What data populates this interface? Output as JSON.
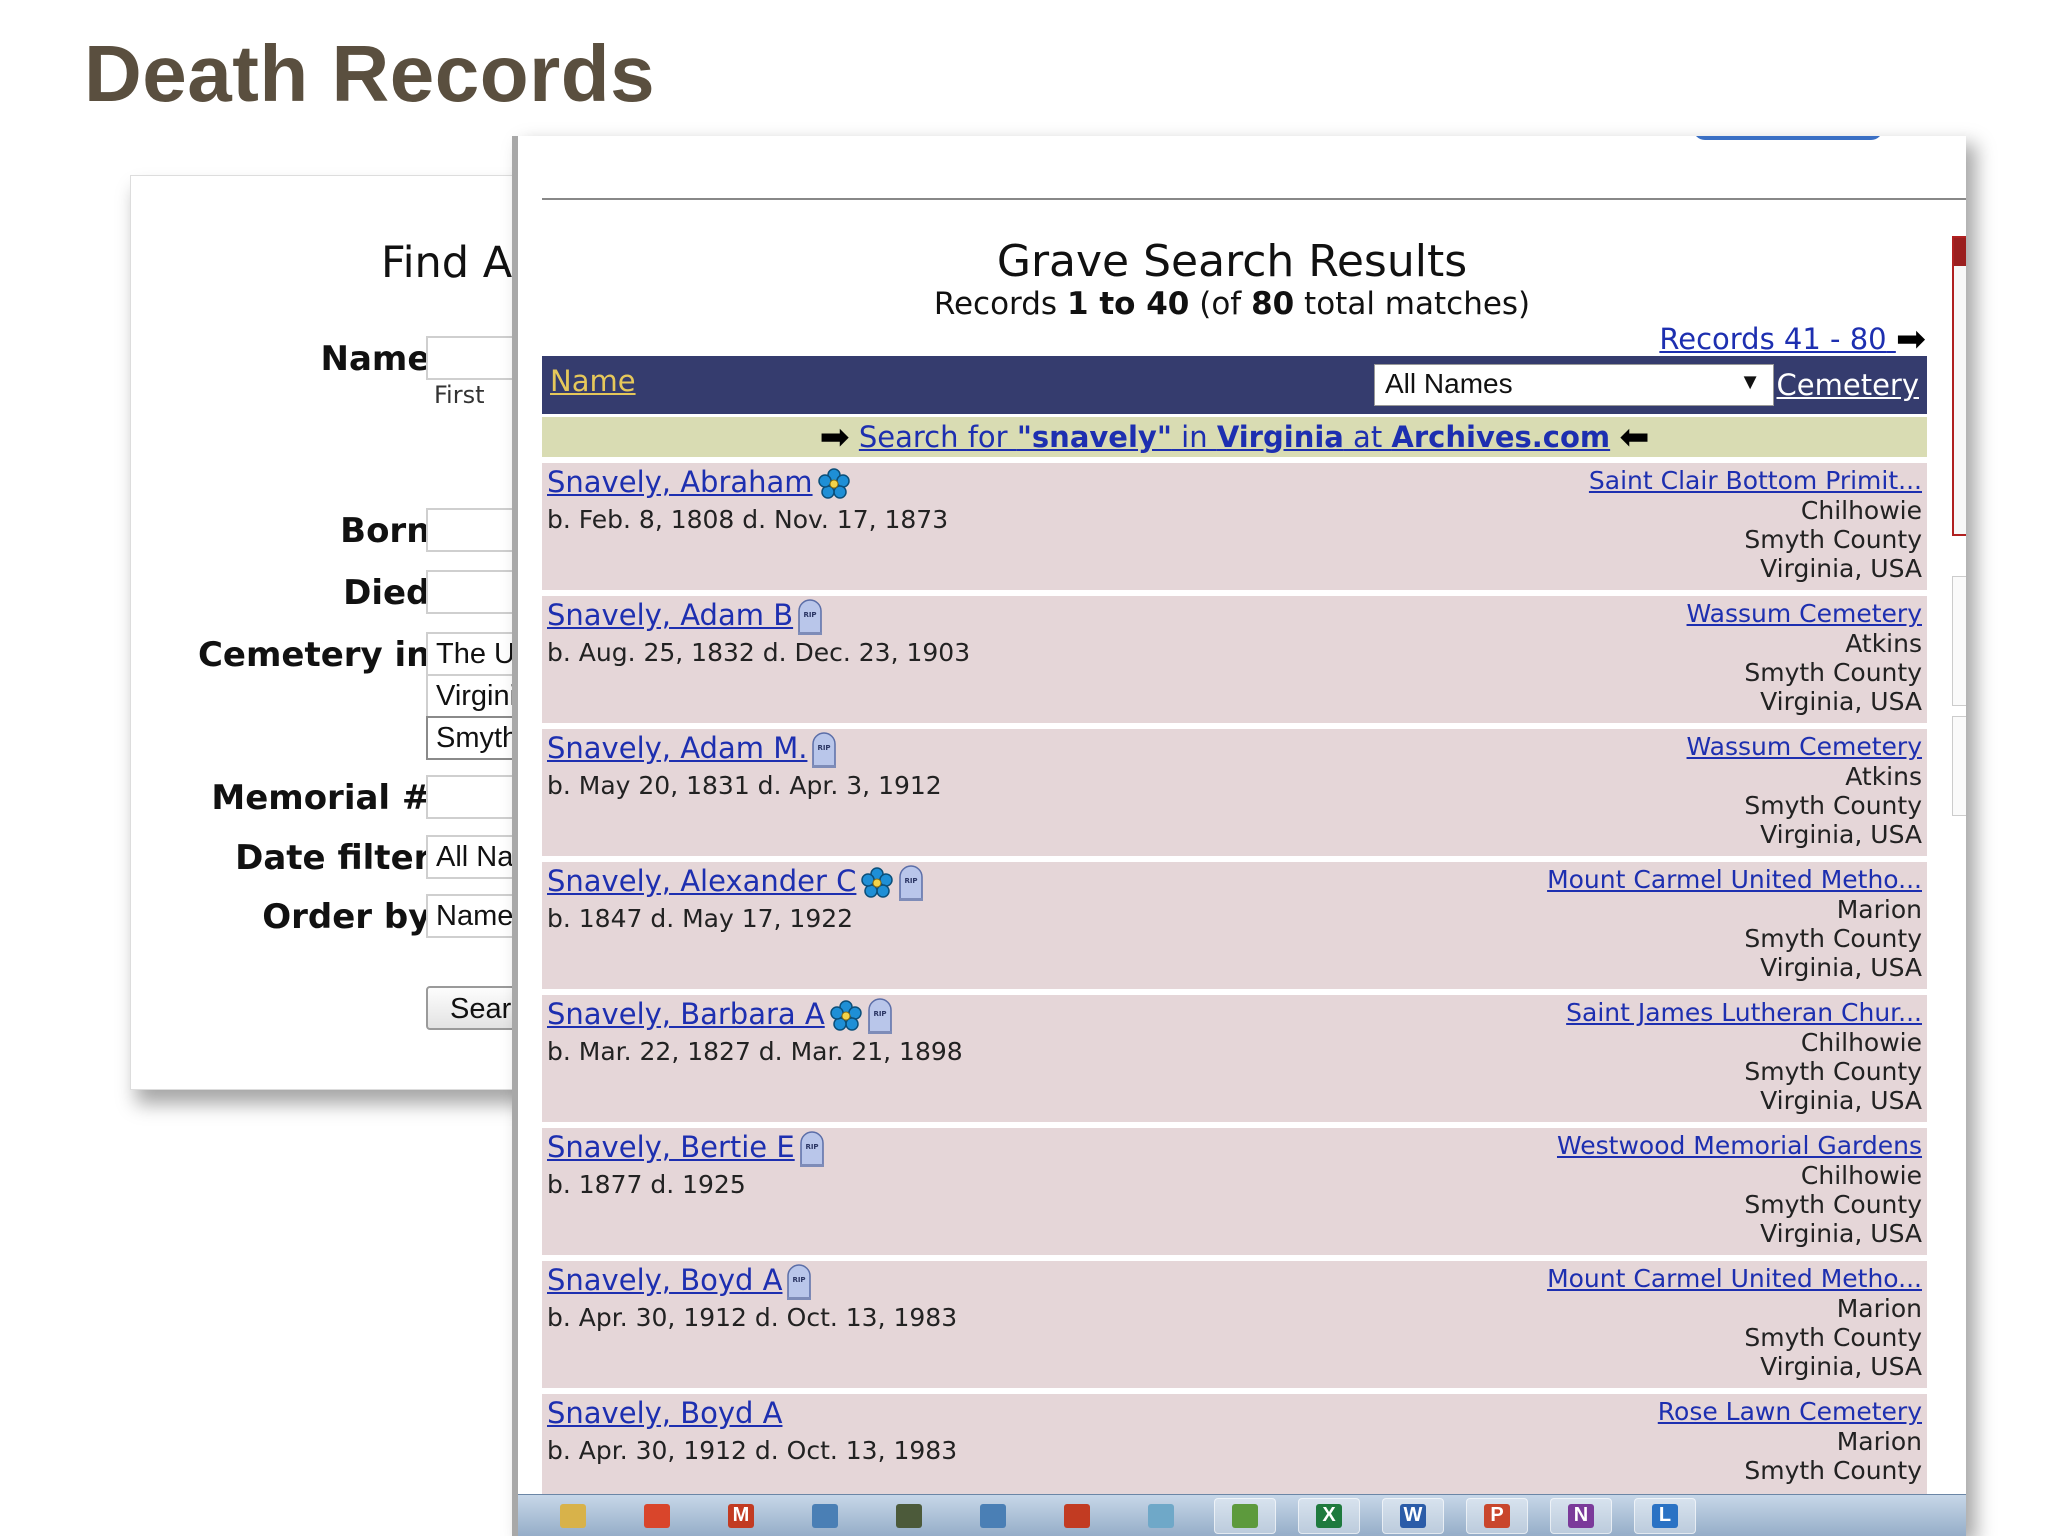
{
  "slide": {
    "title": "Death Records"
  },
  "form": {
    "heading": "Find A",
    "labels": {
      "name": "Name:",
      "born": "Born:",
      "died": "Died:",
      "cemetery_in": "Cemetery in:",
      "memorial": "Memorial #:",
      "date_filter": "Date filter:",
      "order_by": "Order by:"
    },
    "name_sublabel": "First",
    "cemetery_country": "The U",
    "cemetery_state": "Virgini",
    "cemetery_county": "Smyth",
    "date_filter_value": "All Na",
    "order_by_value": "Name",
    "search_button": "Searc"
  },
  "results": {
    "title": "Grave Search Results",
    "sub_prefix": "Records ",
    "range": "1 to 40",
    "sub_mid": " (of ",
    "total": "80",
    "sub_suffix": " total matches)",
    "next_link": "Records 41 - 80",
    "header_name": "Name",
    "filter_value": "All Names",
    "header_cemetery": "Cemetery",
    "archive_prefix": "Search for ",
    "archive_term": "\"snavely\"",
    "archive_in": " in ",
    "archive_state": "Virginia",
    "archive_at": " at ",
    "archive_site": "Archives.com",
    "records": [
      {
        "name": "Snavely, Abraham",
        "icons": [
          "flower"
        ],
        "dates": "b. Feb. 8, 1808 d. Nov. 17, 1873",
        "cemetery": "Saint Clair Bottom Primit...",
        "city": "Chilhowie",
        "county": "Smyth County",
        "state": "Virginia, USA"
      },
      {
        "name": "Snavely, Adam B",
        "icons": [
          "rip"
        ],
        "dates": "b. Aug. 25, 1832 d. Dec. 23, 1903",
        "cemetery": "Wassum Cemetery",
        "city": "Atkins",
        "county": "Smyth County",
        "state": "Virginia, USA"
      },
      {
        "name": "Snavely, Adam M.",
        "icons": [
          "rip"
        ],
        "dates": "b. May 20, 1831 d. Apr. 3, 1912",
        "cemetery": "Wassum Cemetery",
        "city": "Atkins",
        "county": "Smyth County",
        "state": "Virginia, USA"
      },
      {
        "name": "Snavely, Alexander C",
        "icons": [
          "flower",
          "rip"
        ],
        "dates": "b. 1847 d. May 17, 1922",
        "cemetery": "Mount Carmel United Metho...",
        "city": "Marion",
        "county": "Smyth County",
        "state": "Virginia, USA"
      },
      {
        "name": "Snavely, Barbara A",
        "icons": [
          "flower",
          "rip"
        ],
        "dates": "b. Mar. 22, 1827 d. Mar. 21, 1898",
        "cemetery": "Saint James Lutheran Chur...",
        "city": "Chilhowie",
        "county": "Smyth County",
        "state": "Virginia, USA"
      },
      {
        "name": "Snavely, Bertie E",
        "icons": [
          "rip"
        ],
        "dates": "b. 1877 d. 1925",
        "cemetery": "Westwood Memorial Gardens",
        "city": "Chilhowie",
        "county": "Smyth County",
        "state": "Virginia, USA"
      },
      {
        "name": "Snavely, Boyd A",
        "icons": [
          "rip"
        ],
        "dates": "b. Apr. 30, 1912 d. Oct. 13, 1983",
        "cemetery": "Mount Carmel United Metho...",
        "city": "Marion",
        "county": "Smyth County",
        "state": "Virginia, USA"
      },
      {
        "name": "Snavely, Boyd A",
        "icons": [],
        "dates": "b. Apr. 30, 1912 d. Oct. 13, 1983",
        "cemetery": "Rose Lawn Cemetery",
        "city": "Marion",
        "county": "Smyth County",
        "state": ""
      }
    ]
  },
  "taskbar": {
    "apps": [
      {
        "icon": "folder-icon",
        "glyph": "",
        "color": "#d8b24a"
      },
      {
        "icon": "chrome-icon",
        "glyph": "",
        "color": "#d9452b"
      },
      {
        "icon": "gmail-icon",
        "glyph": "M",
        "color": "#c23b22"
      },
      {
        "icon": "app-icon",
        "glyph": "",
        "color": "#4a7fb5"
      },
      {
        "icon": "app-icon",
        "glyph": "",
        "color": "#4c5a3a"
      },
      {
        "icon": "app-icon",
        "glyph": "",
        "color": "#4a7fb5"
      },
      {
        "icon": "pdf-icon",
        "glyph": "",
        "color": "#c23b22"
      },
      {
        "icon": "app-icon",
        "glyph": "",
        "color": "#6fa8c8"
      },
      {
        "icon": "app-icon",
        "glyph": "",
        "color": "#5d9a3d"
      },
      {
        "icon": "excel-icon",
        "glyph": "X",
        "color": "#1f7a3e"
      },
      {
        "icon": "word-icon",
        "glyph": "W",
        "color": "#2b5ca8"
      },
      {
        "icon": "powerpoint-icon",
        "glyph": "P",
        "color": "#c9462c"
      },
      {
        "icon": "onenote-icon",
        "glyph": "N",
        "color": "#7b3a9a"
      },
      {
        "icon": "lync-icon",
        "glyph": "L",
        "color": "#2a72c4"
      }
    ]
  },
  "colors": {
    "title_brown": "#5a4f3f",
    "header_bar": "#353c6e",
    "archive_bar": "#d9dcb3",
    "row_bg": "#e5d6d8",
    "link_blue": "#1d2fb0",
    "header_name_gold": "#e6c85a"
  }
}
